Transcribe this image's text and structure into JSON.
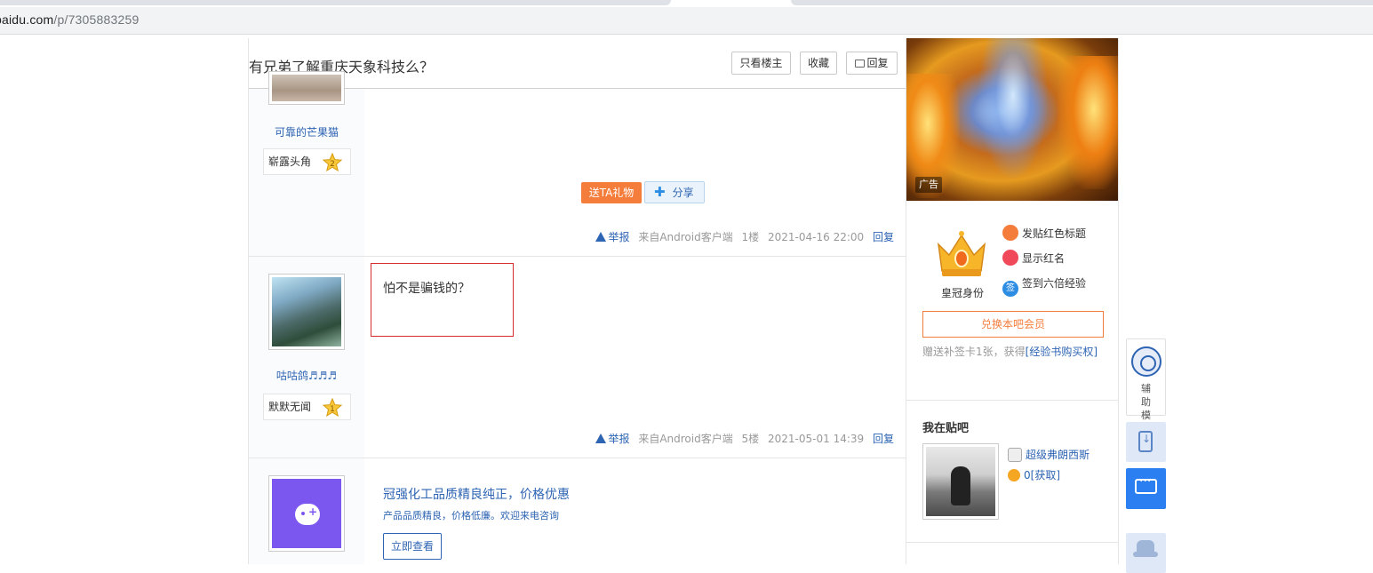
{
  "browser": {
    "url_host": "baidu.com",
    "url_path": "/p/7305883259"
  },
  "thread": {
    "title": "有兄弟了解重庆天象科技么？",
    "btn_louzhu": "只看楼主",
    "btn_fav": "收藏",
    "btn_reply": "回复"
  },
  "posts": [
    {
      "username": "可靠的芒果猫",
      "level_name": "崭露头角",
      "level_num": "2",
      "gift_label": "送TA礼物",
      "share_label": "分享",
      "report_label": "举报",
      "source": "来自Android客户端",
      "floor": "1楼",
      "time": "2021-04-16 22:00",
      "reply_label": "回复"
    },
    {
      "username": "咕咕鸽♬♬♬",
      "level_name": "默默无闻",
      "level_num": "1",
      "content": "怕不是骗钱的？",
      "report_label": "举报",
      "source": "来自Android客户端",
      "floor": "5楼",
      "time": "2021-05-01 14:39",
      "reply_label": "回复"
    }
  ],
  "ad_post": {
    "title": "冠强化工品质精良纯正，价格优惠",
    "subtitle": "产品品质精良，价格低廉。欢迎来电咨询",
    "button": "立即查看"
  },
  "sidebar": {
    "ad_tag": "广告",
    "crown_label": "皇冠身份",
    "features": [
      "发贴红色标题",
      "显示红名",
      "签到六倍经验"
    ],
    "sign_char": "签",
    "exchange_btn": "兑换本吧会员",
    "note_prefix": "赠送补签卡1张，获得",
    "note_link": "[经验书购买权]",
    "my_bar_title": "我在贴吧",
    "my_name": "超级弗朗西斯",
    "my_coin": "0",
    "my_coin_link": "[获取]"
  },
  "tools": {
    "assist_label": "辅助模式"
  },
  "colors": {
    "link": "#2d64b3",
    "accent_orange": "#f57d3c",
    "highlight_red": "#d42b2b",
    "chat_blue": "#2b7ff0"
  }
}
